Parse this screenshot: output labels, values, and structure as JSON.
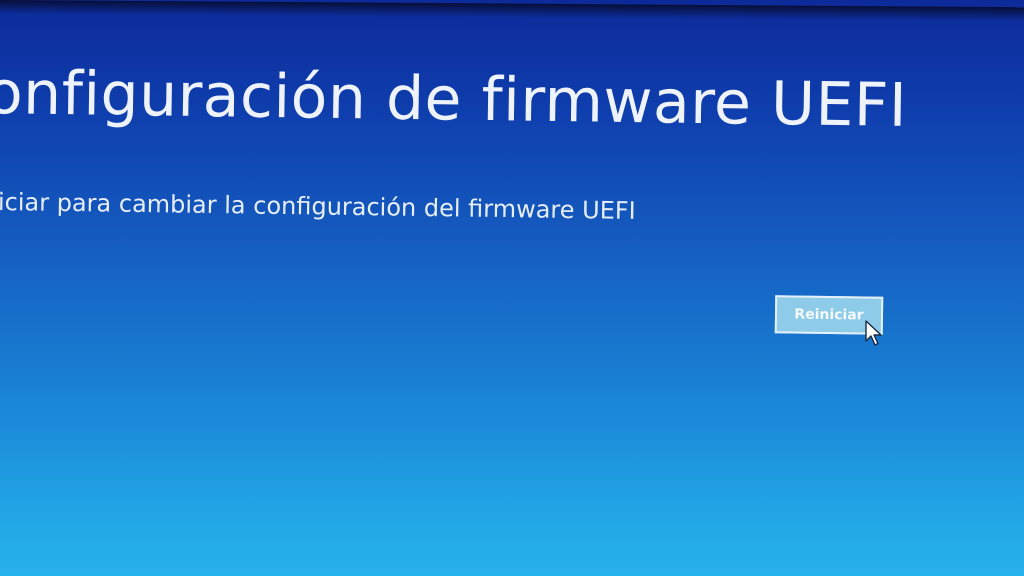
{
  "window": {
    "title": "onfiguración de firmware UEFI",
    "description": "iciar para cambiar la configuración del firmware UEFI"
  },
  "actions": {
    "restart_label": "Reiniciar"
  },
  "icons": {
    "pointer": "mouse-pointer-icon"
  },
  "colors": {
    "background_top": "#0d2a9a",
    "background_bottom": "#26b2ea",
    "button_fill": "#8ecbe9",
    "text": "#eef3fb"
  }
}
